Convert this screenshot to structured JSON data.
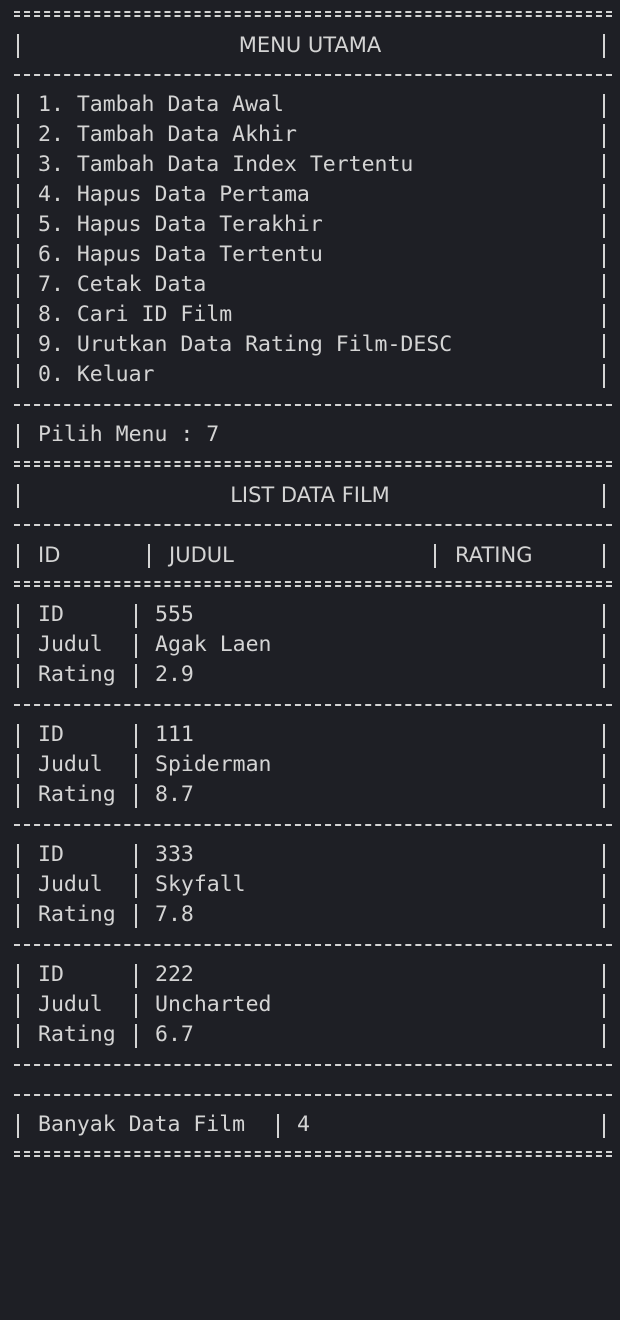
{
  "menu": {
    "title": "MENU UTAMA",
    "items": [
      "1. Tambah Data Awal",
      "2. Tambah Data Akhir",
      "3. Tambah Data Index Tertentu",
      "4. Hapus Data Pertama",
      "5. Hapus Data Terakhir",
      "6. Hapus Data Tertentu",
      "7. Cetak Data",
      "8. Cari ID Film",
      "9. Urutkan Data Rating Film-DESC",
      "0. Keluar"
    ],
    "prompt": "Pilih Menu : 7"
  },
  "list": {
    "title": "LIST DATA FILM",
    "headers": {
      "id": "ID",
      "judul": "JUDUL",
      "rating": "RATING"
    },
    "field_labels": {
      "id": "ID",
      "judul": "Judul",
      "rating": "Rating"
    },
    "films": [
      {
        "id": "555",
        "judul": "Agak Laen",
        "rating": "2.9"
      },
      {
        "id": "111",
        "judul": "Spiderman",
        "rating": "8.7"
      },
      {
        "id": "333",
        "judul": "Skyfall",
        "rating": "7.8"
      },
      {
        "id": "222",
        "judul": "Uncharted",
        "rating": "6.7"
      }
    ]
  },
  "summary": {
    "label": "Banyak Data Film",
    "count": "4"
  }
}
